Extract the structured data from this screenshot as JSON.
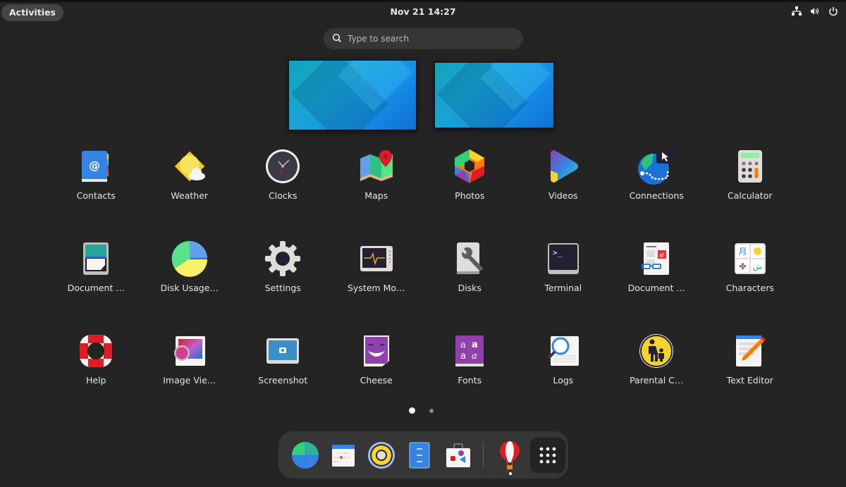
{
  "topbar": {
    "activities_label": "Activities",
    "clock": "Nov 21  14:27",
    "status_icons": [
      "network-wired-icon",
      "volume-icon",
      "power-icon"
    ]
  },
  "search": {
    "placeholder": "Type to search",
    "value": ""
  },
  "workspaces": [
    {
      "name": "Workspace 1"
    },
    {
      "name": "Workspace 2"
    }
  ],
  "apps": [
    {
      "label": "Contacts",
      "icon": "contacts-icon"
    },
    {
      "label": "Weather",
      "icon": "weather-icon"
    },
    {
      "label": "Clocks",
      "icon": "clocks-icon"
    },
    {
      "label": "Maps",
      "icon": "maps-icon"
    },
    {
      "label": "Photos",
      "icon": "photos-icon"
    },
    {
      "label": "Videos",
      "icon": "videos-icon"
    },
    {
      "label": "Connections",
      "icon": "connections-icon"
    },
    {
      "label": "Calculator",
      "icon": "calculator-icon"
    },
    {
      "label": "Document …",
      "icon": "document-scanner-icon"
    },
    {
      "label": "Disk Usage…",
      "icon": "disk-usage-icon"
    },
    {
      "label": "Settings",
      "icon": "settings-icon"
    },
    {
      "label": "System Mo…",
      "icon": "system-monitor-icon"
    },
    {
      "label": "Disks",
      "icon": "disks-icon"
    },
    {
      "label": "Terminal",
      "icon": "terminal-icon"
    },
    {
      "label": "Document …",
      "icon": "document-viewer-icon"
    },
    {
      "label": "Characters",
      "icon": "characters-icon"
    },
    {
      "label": "Help",
      "icon": "help-icon"
    },
    {
      "label": "Image Vie…",
      "icon": "image-viewer-icon"
    },
    {
      "label": "Screenshot",
      "icon": "screenshot-icon"
    },
    {
      "label": "Cheese",
      "icon": "cheese-icon"
    },
    {
      "label": "Fonts",
      "icon": "fonts-icon"
    },
    {
      "label": "Logs",
      "icon": "logs-icon"
    },
    {
      "label": "Parental C…",
      "icon": "parental-controls-icon"
    },
    {
      "label": "Text Editor",
      "icon": "text-editor-icon"
    }
  ],
  "pagination": {
    "current_page": 1,
    "total_pages": 2
  },
  "dock": {
    "items": [
      {
        "name": "Web Browser",
        "icon": "browser-globe-icon"
      },
      {
        "name": "Calendar",
        "icon": "calendar-icon"
      },
      {
        "name": "Music",
        "icon": "music-speaker-icon"
      },
      {
        "name": "Files",
        "icon": "files-cabinet-icon"
      },
      {
        "name": "Software",
        "icon": "software-store-icon"
      },
      {
        "name": "Balloon App",
        "icon": "hot-air-balloon-icon",
        "running": true
      }
    ],
    "show_apps_icon": "app-grid-icon"
  }
}
